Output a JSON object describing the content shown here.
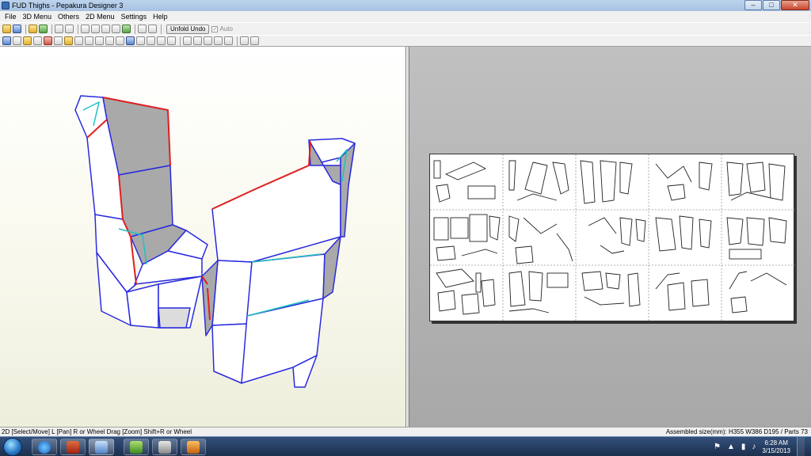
{
  "window": {
    "title": "FUD Thighs - Pepakura Designer 3",
    "minimize_label": "–",
    "maximize_label": "□",
    "close_label": "✕"
  },
  "menu": {
    "items": [
      "File",
      "3D Menu",
      "Others",
      "2D Menu",
      "Settings",
      "Help"
    ]
  },
  "toolbar": {
    "unfold_undo_label": "Unfold Undo",
    "auto_label": "Auto",
    "auto_checked": true
  },
  "status": {
    "left_text": "2D [Select/Move] L [Pan] R or Wheel Drag [Zoom] Shift+R or Wheel",
    "right_text": "Assembled size(mm): H355 W386 D195 / Parts 73"
  },
  "taskbar": {
    "apps": [
      "internet-explorer-icon",
      "pepakura-icon",
      "pepakura-designer-icon",
      "notepad-icon",
      "media-player-icon",
      "archive-icon"
    ],
    "clock_time": "6:28 AM",
    "clock_date": "3/15/2013"
  },
  "colors": {
    "mesh_edge": "#2a2ae0",
    "cut_edge": "#e02020",
    "fold_edge": "#20c0c0",
    "face_light": "#ffffff",
    "face_shadow": "#a8a8a8"
  }
}
